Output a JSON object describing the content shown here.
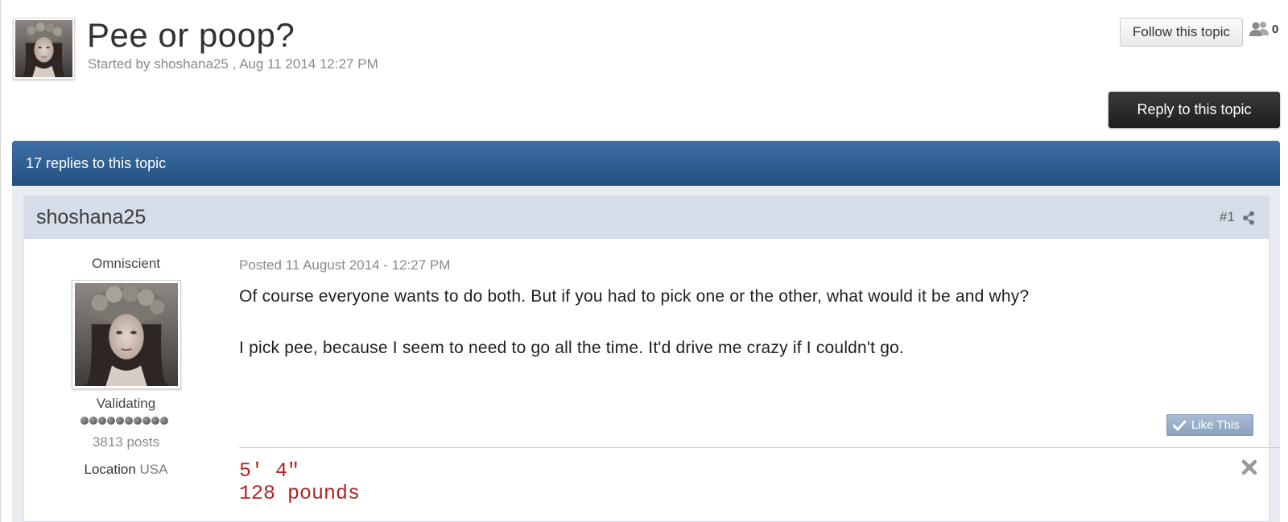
{
  "topic": {
    "title": "Pee or poop?",
    "meta": "Started by shoshana25 , Aug 11 2014 12:27 PM",
    "follow_label": "Follow this topic",
    "follower_count": "0",
    "reply_label": "Reply to this topic",
    "replies_text": "17 replies to this topic"
  },
  "post": {
    "author": "shoshana25",
    "number": "#1",
    "rank_title": "Omniscient",
    "group": "Validating",
    "pips": 10,
    "post_count": "3813 posts",
    "location_label": "Location",
    "location_value": "USA",
    "posted": "Posted 11 August 2014 - 12:27 PM",
    "paragraphs": [
      "Of course everyone wants to do both. But if you had to pick one or the other, what would it be and why?",
      "I pick pee, because I seem to need to go all the time. It'd drive me crazy if I couldn't go."
    ],
    "like_label": "Like This",
    "signature": [
      "5' 4\"",
      "128 pounds"
    ]
  },
  "colors": {
    "replies_bar": "#2f5f93",
    "post_header": "#d5dde8",
    "signature": "#b22222",
    "reply_button": "#2a2a2a"
  },
  "icons": [
    "user-avatar",
    "followers-icon",
    "share-icon",
    "check-icon",
    "close-icon"
  ]
}
